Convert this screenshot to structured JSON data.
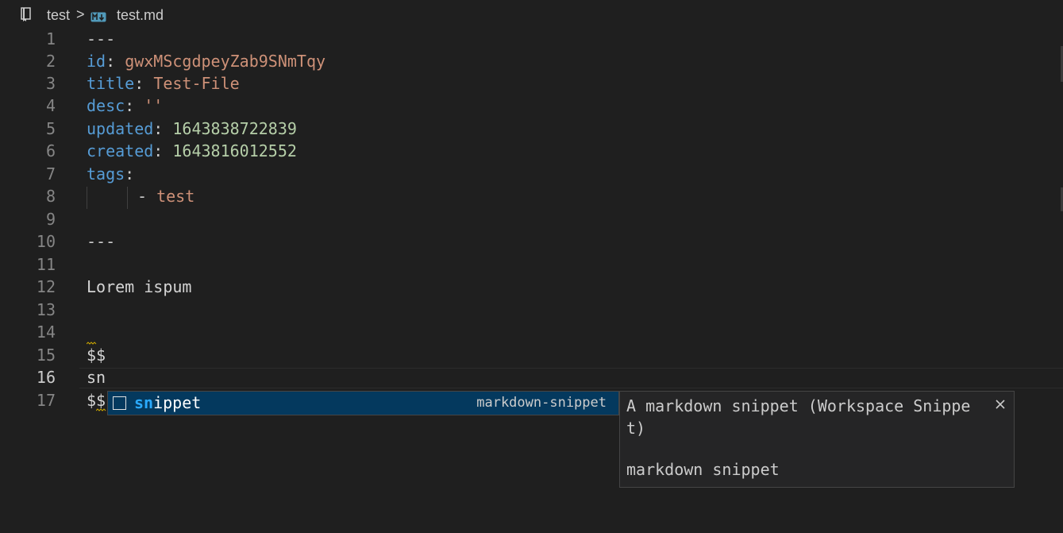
{
  "breadcrumb": {
    "folder": "test",
    "separator": ">",
    "file": "test.md",
    "folder_icon": "notebook-icon",
    "file_icon": "markdown-icon"
  },
  "editor": {
    "line_numbers": [
      "1",
      "2",
      "3",
      "4",
      "5",
      "6",
      "7",
      "8",
      "9",
      "10",
      "11",
      "12",
      "13",
      "14",
      "15",
      "16",
      "17"
    ],
    "active_line": "16",
    "lines": {
      "l1": "---",
      "l2_key": "id",
      "l2_sep": ":",
      "l2_val": "gwxMScgdpeyZab9SNmTqy",
      "l3_key": "title",
      "l3_sep": ":",
      "l3_val": "Test-File",
      "l4_key": "desc",
      "l4_sep": ":",
      "l4_val": "''",
      "l5_key": "updated",
      "l5_sep": ":",
      "l5_val": "1643838722839",
      "l6_key": "created",
      "l6_sep": ":",
      "l6_val": "1643816012552",
      "l7_key": "tags",
      "l7_sep": ":",
      "l8_dash": "-",
      "l8_val": "test",
      "l10": "---",
      "l12": "Lorem ispum",
      "l15": "$$",
      "l16": "sn",
      "l17": "$$"
    }
  },
  "suggest": {
    "item_icon": "snippet-icon",
    "label_match": "sn",
    "label_rest": "ippet",
    "detail": "markdown-snippet"
  },
  "details": {
    "description": "A markdown snippet (Workspace Snippet)",
    "documentation": "markdown snippet",
    "close_icon": "close-icon"
  },
  "colors": {
    "background": "#1f1f1f",
    "key": "#569cd6",
    "string": "#ce9178",
    "number": "#b5cea8",
    "suggest_selected": "#04395e",
    "match_highlight": "#2aaaff"
  }
}
